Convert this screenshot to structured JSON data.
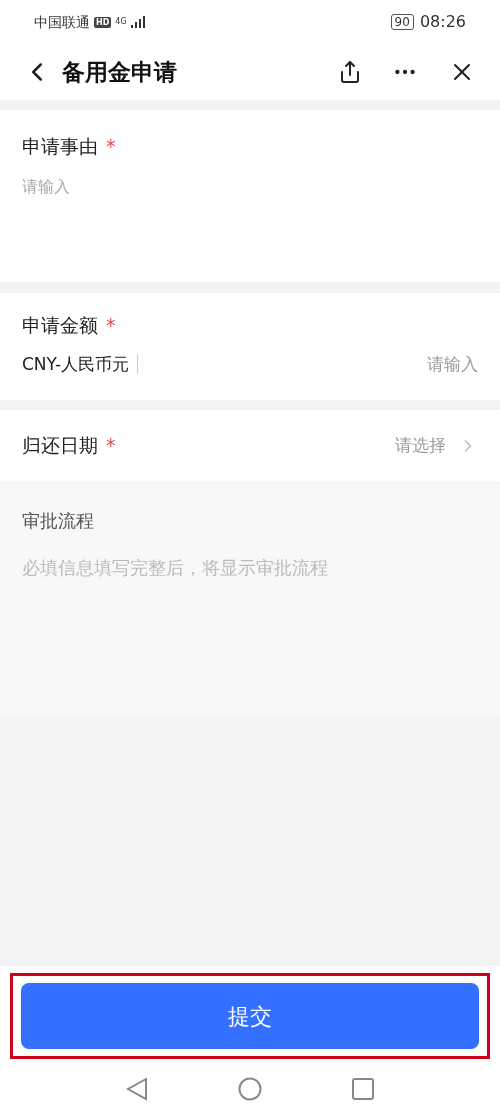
{
  "status_bar": {
    "carrier": "中国联通",
    "hd": "HD",
    "network": "4G",
    "battery": "90",
    "time": "08:26"
  },
  "header": {
    "title": "备用金申请"
  },
  "form": {
    "reason": {
      "label": "申请事由",
      "required_mark": "*",
      "placeholder": "请输入"
    },
    "amount": {
      "label": "申请金额",
      "required_mark": "*",
      "currency": "CNY-人民币元",
      "placeholder": "请输入"
    },
    "return_date": {
      "label": "归还日期",
      "required_mark": "*",
      "placeholder": "请选择"
    }
  },
  "approval": {
    "title": "审批流程",
    "hint": "必填信息填写完整后，将显示审批流程"
  },
  "submit": {
    "label": "提交",
    "highlighted": true
  }
}
